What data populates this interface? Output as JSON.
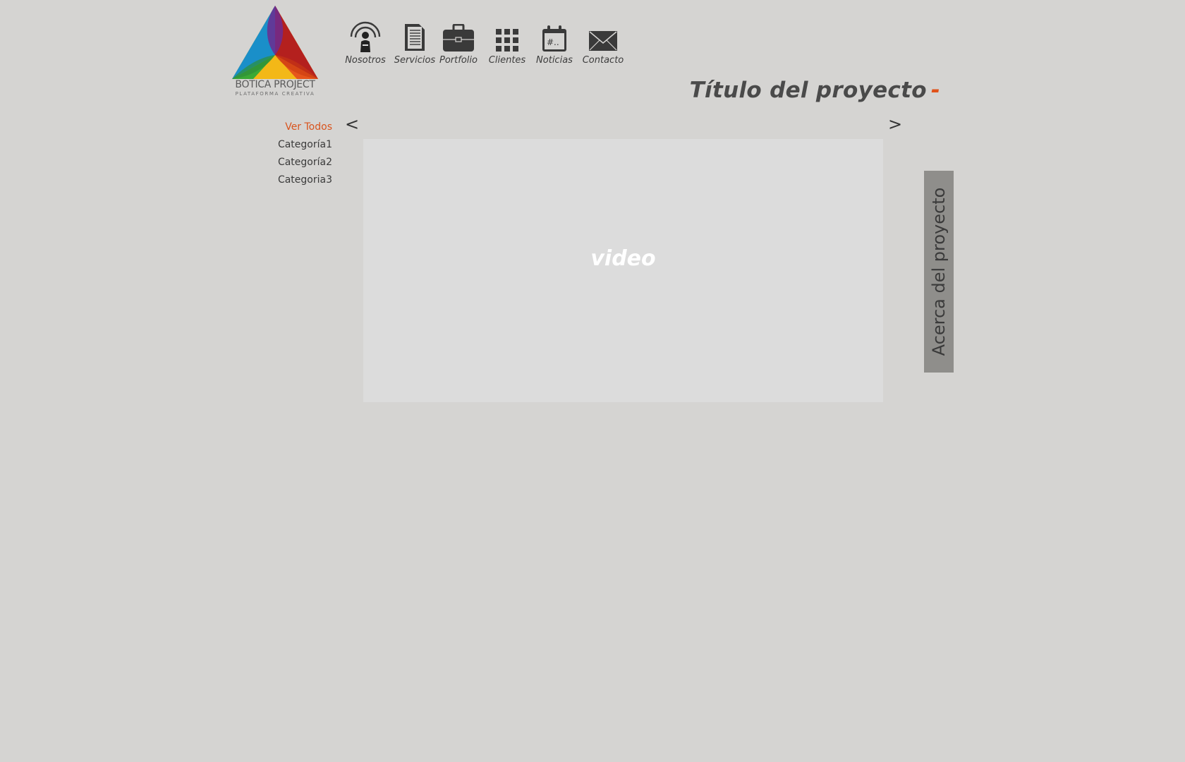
{
  "brand": {
    "name": "BOTICA PROJECT",
    "tagline": "PLATAFORMA CREATIVA",
    "colors": [
      "#1a8fc9",
      "#b4201e",
      "#f3b817",
      "#3aa935",
      "#e6561b",
      "#6d2b8f"
    ]
  },
  "nav": [
    {
      "label": "Nosotros",
      "icon": "speaker-person-icon"
    },
    {
      "label": "Servicios",
      "icon": "document-icon"
    },
    {
      "label": "Portfolio",
      "icon": "briefcase-icon"
    },
    {
      "label": "Clientes",
      "icon": "grid-icon"
    },
    {
      "label": "Noticias",
      "icon": "calendar-icon",
      "icon_text": "#.."
    },
    {
      "label": "Contacto",
      "icon": "envelope-icon"
    }
  ],
  "project": {
    "title": "Título del proyecto",
    "title_suffix": "-",
    "accent": "#e0521a"
  },
  "categories": [
    {
      "label": "Ver Todos",
      "active": true
    },
    {
      "label": "Categoría1",
      "active": false
    },
    {
      "label": "Categoría2",
      "active": false
    },
    {
      "label": "Categoria3",
      "active": false
    }
  ],
  "gallery": {
    "prev_label": "<",
    "next_label": ">",
    "video_label": "video"
  },
  "about": {
    "label": "Acerca del proyecto"
  }
}
